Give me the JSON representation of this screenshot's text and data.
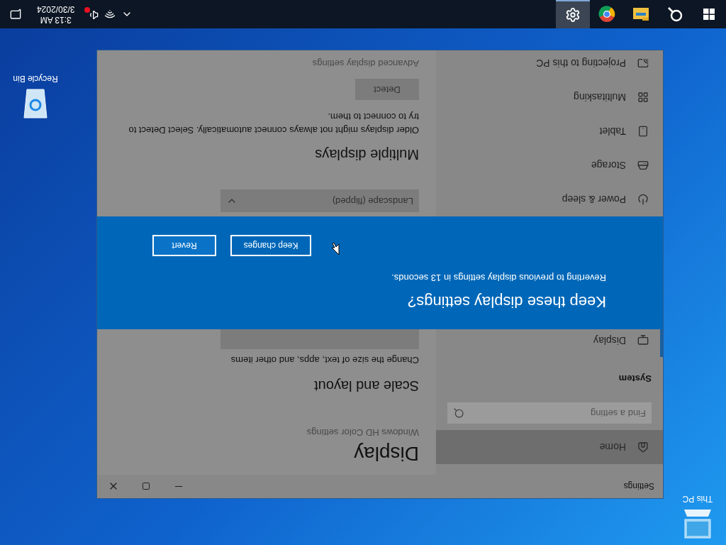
{
  "desktop_icons": [
    {
      "kind": "pc",
      "label": "This PC"
    },
    {
      "kind": "bin",
      "label": "Recycle Bin"
    }
  ],
  "window": {
    "title": "Settings",
    "sidebar": {
      "home": {
        "label": "Home",
        "highlighted": true
      },
      "search": {
        "placeholder": "Find a setting"
      },
      "section": "System",
      "items_above": [
        {
          "kind": "display",
          "label": "Display",
          "selected": true
        }
      ],
      "items_below": [
        {
          "kind": "power",
          "label": "Power & sleep",
          "selected": false
        },
        {
          "kind": "storage",
          "label": "Storage",
          "selected": false
        },
        {
          "kind": "tablet",
          "label": "Tablet",
          "selected": false
        },
        {
          "kind": "multitasking",
          "label": "Multitasking",
          "selected": false
        },
        {
          "kind": "projecting",
          "label": "Projecting to this PC",
          "selected": false
        }
      ]
    },
    "content": {
      "title": "Display",
      "hdr_link": "Windows HD Color settings",
      "scale_heading": "Scale and layout",
      "scale_description": "Change the size of text, apps, and other items",
      "orientation_value": "Landscape (flipped)",
      "multiple_heading": "Multiple displays",
      "multiple_description": "Older displays might not always connect automatically. Select Detect to try to connect to them.",
      "detect_button": "Detect",
      "advanced_link": "Advanced display settings"
    }
  },
  "dialog": {
    "title": "Keep these display settings?",
    "message": "Reverting to previous display settings in 13 seconds.",
    "buttons": [
      "Keep changes",
      "Revert"
    ]
  },
  "taskbar": {
    "apps": [
      {
        "kind": "search",
        "selected": false
      },
      {
        "kind": "explorer",
        "selected": false
      },
      {
        "kind": "chrome",
        "selected": false
      },
      {
        "kind": "settings",
        "selected": true
      }
    ],
    "volume_muted": true,
    "time": "3:13 AM",
    "date": "3/30/2024"
  }
}
